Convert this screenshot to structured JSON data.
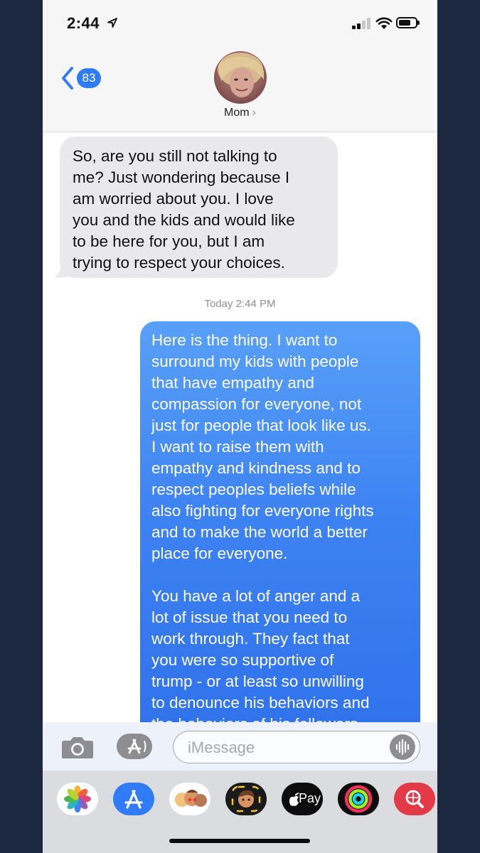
{
  "status_bar": {
    "time": "2:44"
  },
  "header": {
    "back_count": "83",
    "contact_name": "Mom",
    "contact_chevron": "›"
  },
  "conversation": {
    "incoming": {
      "lines": [
        "So, are you still not talking to",
        "me? Just wondering because I",
        "am worried about you. I love",
        "you and the kids and would like",
        "to be here for you, but I am",
        "trying to respect your choices."
      ]
    },
    "timestamp": "Today 2:44 PM",
    "outgoing": {
      "paragraph1": [
        "Here is the thing. I want to",
        "surround my kids with people",
        "that have empathy and",
        "compassion for everyone, not",
        "just for people that look like us.",
        "I want to raise them with",
        "empathy and kindness and to",
        "respect peoples beliefs while",
        "also fighting for everyone rights",
        "and to make the world a better",
        "place for everyone."
      ],
      "paragraph2": [
        "You have a lot of anger and a",
        "lot of issue that you need to",
        "work through. They fact that",
        "you were so supportive of",
        "trump - or at least so unwilling",
        "to denounce his behaviors and",
        "the behaviors of his followers"
      ]
    }
  },
  "compose": {
    "placeholder": "iMessage"
  },
  "app_drawer": {
    "apple_pay_label": "Pay",
    "apps": [
      "photos-icon",
      "app-store-icon",
      "memoji-stickers-icon",
      "animoji-icon",
      "apple-pay-icon",
      "activity-icon",
      "web-search-icon"
    ]
  },
  "colors": {
    "imessage_blue": "#3d82f2",
    "incoming_gray": "#e9e9eb",
    "badge_blue": "#2f7cf6",
    "background": "#1c2740"
  }
}
